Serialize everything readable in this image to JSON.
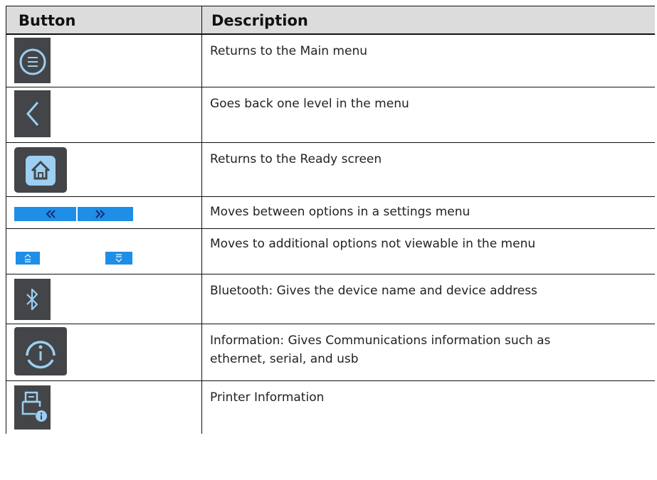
{
  "table": {
    "headers": {
      "button": "Button",
      "description": "Description"
    },
    "rows": [
      {
        "icon": "main-menu-icon",
        "description": "Returns to the Main menu"
      },
      {
        "icon": "back-chevron-icon",
        "description": "Goes back one level in the menu"
      },
      {
        "icon": "home-icon",
        "description": "Returns to the Ready screen"
      },
      {
        "icon": "prev-next-arrows-icon",
        "description": "Moves between options in a settings menu"
      },
      {
        "icon": "scroll-up-down-icon",
        "description": "Moves to additional options not viewable in the menu"
      },
      {
        "icon": "bluetooth-icon",
        "description": "Bluetooth: Gives the device name and device address"
      },
      {
        "icon": "information-icon",
        "description": "Information: Gives Communications information such as\nethernet, serial, and usb"
      },
      {
        "icon": "printer-information-icon",
        "description": "Printer Information"
      }
    ]
  },
  "colors": {
    "icon_bg": "#434548",
    "icon_line": "#9ccff2",
    "button_blue": "#1e8ee6"
  }
}
